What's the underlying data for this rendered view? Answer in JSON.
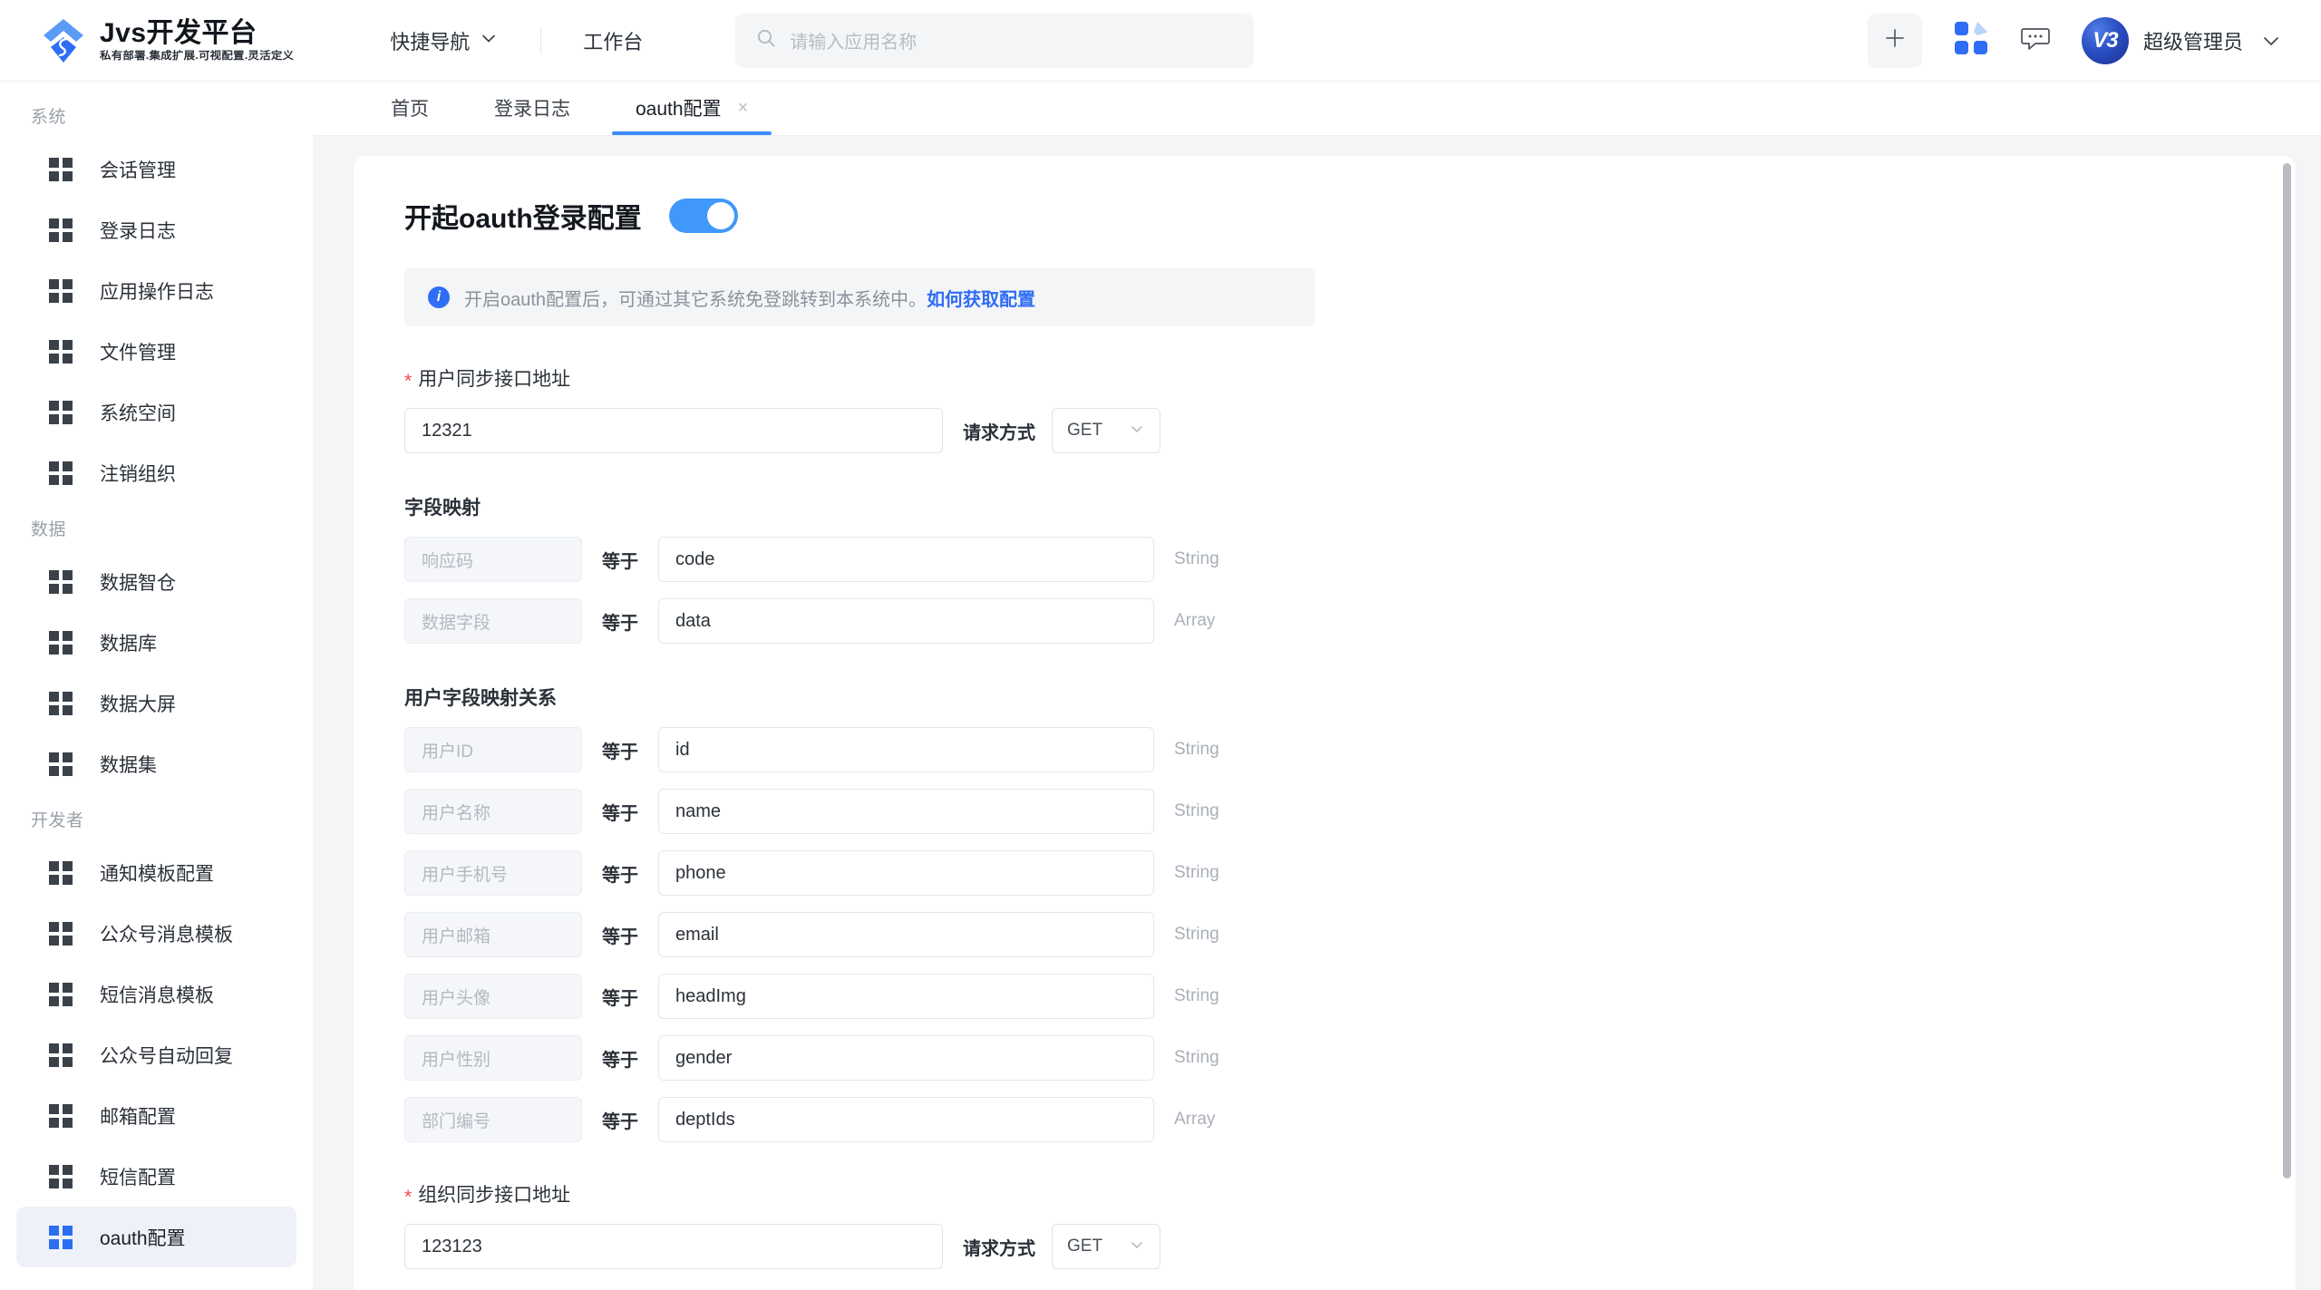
{
  "header": {
    "brand_title": "Jvs开发平台",
    "brand_sub": "私有部署.集成扩展.可视配置.灵活定义",
    "nav": [
      {
        "label": "快捷导航",
        "has_chevron": true
      },
      {
        "label": "工作台",
        "has_chevron": false
      }
    ],
    "search": {
      "placeholder": "请输入应用名称",
      "value": "",
      "icon": "search-icon"
    },
    "actions": {
      "plus": "+",
      "apps_icon": "apps-grid-icon",
      "chat_icon": "chat-bubble-icon"
    },
    "user": {
      "avatar_text": "V3",
      "name": "超级管理员"
    }
  },
  "tabs": [
    {
      "label": "首页",
      "active": false,
      "closable": false
    },
    {
      "label": "登录日志",
      "active": false,
      "closable": false
    },
    {
      "label": "oauth配置",
      "active": true,
      "closable": true,
      "close_glyph": "×"
    }
  ],
  "sidebar": {
    "groups": [
      {
        "title": "系统",
        "items": [
          {
            "label": "会话管理",
            "active": false
          },
          {
            "label": "登录日志",
            "active": false
          },
          {
            "label": "应用操作日志",
            "active": false
          },
          {
            "label": "文件管理",
            "active": false
          },
          {
            "label": "系统空间",
            "active": false
          },
          {
            "label": "注销组织",
            "active": false
          }
        ]
      },
      {
        "title": "数据",
        "items": [
          {
            "label": "数据智仓",
            "active": false
          },
          {
            "label": "数据库",
            "active": false
          },
          {
            "label": "数据大屏",
            "active": false
          },
          {
            "label": "数据集",
            "active": false
          }
        ]
      },
      {
        "title": "开发者",
        "items": [
          {
            "label": "通知模板配置",
            "active": false
          },
          {
            "label": "公众号消息模板",
            "active": false
          },
          {
            "label": "短信消息模板",
            "active": false
          },
          {
            "label": "公众号自动回复",
            "active": false
          },
          {
            "label": "邮箱配置",
            "active": false
          },
          {
            "label": "短信配置",
            "active": false
          },
          {
            "label": "oauth配置",
            "active": true
          }
        ]
      }
    ]
  },
  "main": {
    "page_title": "开起oauth登录配置",
    "toggle_on": true,
    "alert": {
      "icon": "info-circle-icon",
      "text": "开启oauth配置后，可通过其它系统免登跳转到本系统中。",
      "link_text": "如何获取配置"
    },
    "user_api": {
      "required_mark": "*",
      "label": "用户同步接口地址",
      "value": "12321",
      "method_label": "请求方式",
      "method_value": "GET"
    },
    "field_mapping": {
      "title": "字段映射",
      "rows": [
        {
          "key_placeholder": "响应码",
          "value": "code",
          "type": "String"
        },
        {
          "key_placeholder": "数据字段",
          "value": "data",
          "type": "Array"
        }
      ]
    },
    "user_field_mapping": {
      "title": "用户字段映射关系",
      "rows": [
        {
          "key_placeholder": "用户ID",
          "value": "id",
          "type": "String"
        },
        {
          "key_placeholder": "用户名称",
          "value": "name",
          "type": "String"
        },
        {
          "key_placeholder": "用户手机号",
          "value": "phone",
          "type": "String"
        },
        {
          "key_placeholder": "用户邮箱",
          "value": "email",
          "type": "String"
        },
        {
          "key_placeholder": "用户头像",
          "value": "headImg",
          "type": "String"
        },
        {
          "key_placeholder": "用户性别",
          "value": "gender",
          "type": "String"
        },
        {
          "key_placeholder": "部门编号",
          "value": "deptIds",
          "type": "Array"
        }
      ]
    },
    "org_api": {
      "required_mark": "*",
      "label": "组织同步接口地址",
      "value": "123123",
      "method_label": "请求方式",
      "method_value": "GET"
    },
    "equals_label": "等于"
  },
  "colors": {
    "accent_blue": "#2c6ef2",
    "toggle_blue": "#4098fb",
    "tab_underline": "#3d8bfd",
    "required_red": "#f04a4a",
    "link_blue": "#2f6df6"
  }
}
